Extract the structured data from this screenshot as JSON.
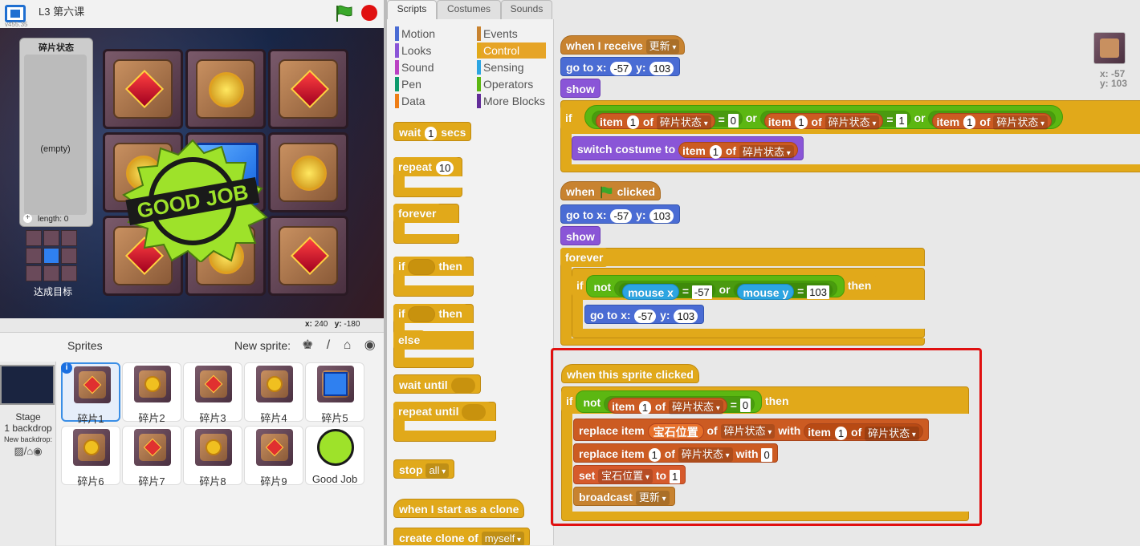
{
  "app": {
    "title": "L3 第六课",
    "version": "v455.35"
  },
  "stage": {
    "list_monitor": {
      "title": "碎片状态",
      "empty_text": "(empty)",
      "plus": "+",
      "length_text": "length: 0"
    },
    "target_label": "达成目标",
    "good_job": "GOOD JOB",
    "coords": {
      "x_label": "x:",
      "x_value": "240",
      "y_label": "y:",
      "y_value": "-180"
    }
  },
  "sprites_panel": {
    "title": "Sprites",
    "new_sprite_label": "New sprite:",
    "new_sprite_icons": "♚ / ⌂ ◉",
    "stage_label": "Stage",
    "backdrop_count": "1 backdrop",
    "new_backdrop_label": "New backdrop:",
    "backdrop_icons": "▨/⌂◉",
    "info_badge": "i",
    "sprites": [
      {
        "name": "碎片1",
        "gem": "red",
        "selected": true
      },
      {
        "name": "碎片2",
        "gem": "yellow"
      },
      {
        "name": "碎片3",
        "gem": "red"
      },
      {
        "name": "碎片4",
        "gem": "yellow"
      },
      {
        "name": "碎片5",
        "gem": "blue"
      },
      {
        "name": "碎片6",
        "gem": "yellow"
      },
      {
        "name": "碎片7",
        "gem": "red"
      },
      {
        "name": "碎片8",
        "gem": "yellow"
      },
      {
        "name": "碎片9",
        "gem": "red"
      },
      {
        "name": "Good Job",
        "gem": "stamp"
      }
    ]
  },
  "tabs": [
    "Scripts",
    "Costumes",
    "Sounds"
  ],
  "categories": {
    "left": [
      {
        "label": "Motion",
        "color": "#4a6cd4"
      },
      {
        "label": "Looks",
        "color": "#8a55d7"
      },
      {
        "label": "Sound",
        "color": "#bb42c3"
      },
      {
        "label": "Pen",
        "color": "#0e9a6c"
      },
      {
        "label": "Data",
        "color": "#ee7d16"
      }
    ],
    "right": [
      {
        "label": "Events",
        "color": "#c88330"
      },
      {
        "label": "Control",
        "color": "#e1a91a",
        "active": true
      },
      {
        "label": "Sensing",
        "color": "#2ca5e2"
      },
      {
        "label": "Operators",
        "color": "#5cb712"
      },
      {
        "label": "More Blocks",
        "color": "#632d99"
      }
    ]
  },
  "palette": {
    "wait": "wait",
    "wait_val": "1",
    "secs": "secs",
    "repeat": "repeat",
    "repeat_val": "10",
    "forever": "forever",
    "if": "if",
    "then": "then",
    "else": "else",
    "wait_until": "wait until",
    "repeat_until": "repeat until",
    "stop": "stop",
    "stop_val": "all",
    "clone_hat": "when I start as a clone",
    "create_clone": "create clone of",
    "clone_val": "myself"
  },
  "scripts": {
    "s1": {
      "hat": "when I receive",
      "hat_msg": "更新",
      "goto": "go to x:",
      "x": "-57",
      "y_label": "y:",
      "y": "103",
      "show": "show",
      "if": "if",
      "item": "item",
      "idx": "1",
      "of": "of",
      "list": "碎片状态",
      "eq": "=",
      "v0": "0",
      "or": "or",
      "v1": "1",
      "switch": "switch costume to"
    },
    "s2": {
      "hat_pre": "when",
      "hat_post": "clicked",
      "goto": "go to x:",
      "x": "-57",
      "y_label": "y:",
      "y": "103",
      "show": "show",
      "forever": "forever",
      "if": "if",
      "not": "not",
      "mouse_x": "mouse x",
      "eq": "=",
      "xv": "-57",
      "or": "or",
      "mouse_y": "mouse y",
      "yv": "103",
      "then": "then"
    },
    "s3": {
      "hat": "when this sprite clicked",
      "if": "if",
      "not": "not",
      "item": "item",
      "idx": "1",
      "of": "of",
      "list": "碎片状态",
      "eq": "=",
      "v0": "0",
      "then": "then",
      "replace": "replace item",
      "var": "宝石位置",
      "with": "with",
      "set": "set",
      "to": "to",
      "set_val": "1",
      "broadcast": "broadcast",
      "msg": "更新"
    }
  },
  "sprite_info": {
    "x_text": "x: -57",
    "y_text": "y: 103"
  }
}
